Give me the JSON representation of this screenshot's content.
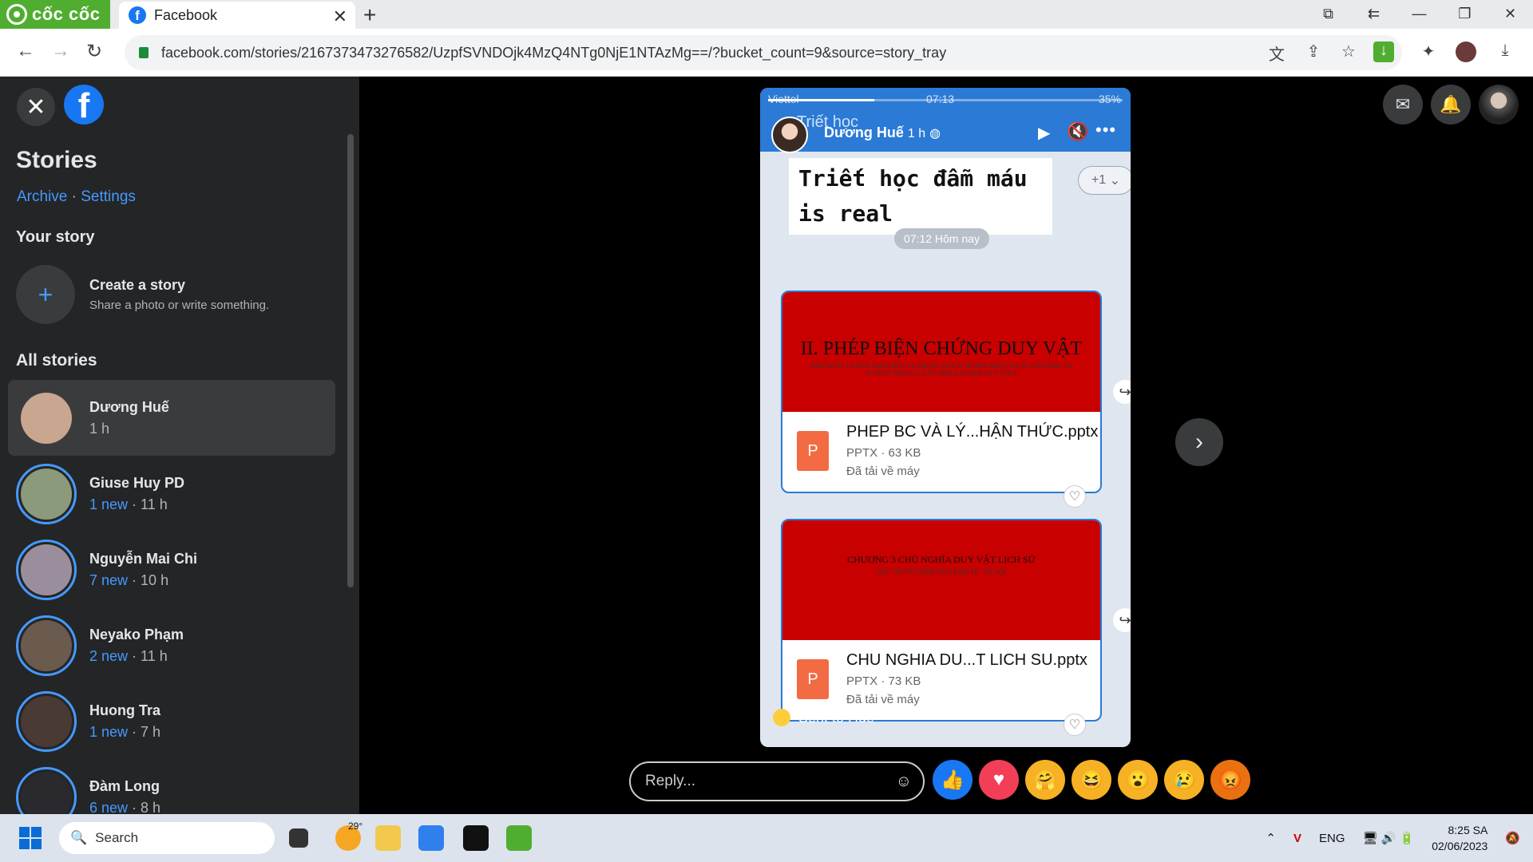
{
  "browser": {
    "brand": "cốc cốc",
    "tab_title": "Facebook",
    "url": "facebook.com/stories/2167373473276582/UzpfSVNDOjk4MzQ4NTg0NjE1NTAzMg==/?bucket_count=9&source=story_tray"
  },
  "sidebar": {
    "title": "Stories",
    "archive": "Archive",
    "settings": "Settings",
    "separator": "·",
    "your_story": "Your story",
    "create_title": "Create a story",
    "create_sub": "Share a photo or write something.",
    "all_stories": "All stories",
    "stories": [
      {
        "name": "Dương Huế",
        "new": "",
        "time": "1 h",
        "color": "#c9a68f"
      },
      {
        "name": "Giuse Huy PD",
        "new": "1 new",
        "time": "11 h",
        "color": "#8a9a7a"
      },
      {
        "name": "Nguyễn Mai Chi",
        "new": "7 new",
        "time": "10 h",
        "color": "#9a8e9c"
      },
      {
        "name": "Neyako Phạm",
        "new": "2 new",
        "time": "11 h",
        "color": "#6b5a4e"
      },
      {
        "name": "Huong Tra",
        "new": "1 new",
        "time": "7 h",
        "color": "#4a3a34"
      },
      {
        "name": "Đàm Long",
        "new": "6 new",
        "time": "8 h",
        "color": "#2a2a2e"
      }
    ],
    "meta_sep": " · "
  },
  "story": {
    "progress": 0.3,
    "status_left": "Viettel",
    "status_time": "07:13",
    "status_right": "35%",
    "ghost_title": "Triết học",
    "author": "Dương Huế",
    "author_time": "1 h",
    "caption": "Triết học đẫm máu is real",
    "plus_one": "+1",
    "day_chip": "07:12 Hôm nay",
    "files": [
      {
        "thumb_title": "II. PHÉP BIỆN CHỨNG DUY VẬT",
        "thumb_sub": "PHEP BCDV LA MON KHOA HOC VE NHUNG QUY LUAT PHO BIEN CUA SU VAN DONG VA SU PHAT TRIEN CUA TU NHIEN, XA HOI VA TU DUY",
        "name": "PHEP BC VÀ LÝ...HẬN THỨC.pptx",
        "meta": "PPTX · 63 KB",
        "status": "Đã tải về máy"
      },
      {
        "thumb_title": "CHƯƠNG 3 CHỦ NGHĨA DUY VẬT LỊCH SỬ",
        "thumb_sub": "HỌC THUYẾT HÌNH THÁI KINH TẾ - XÃ HỘI",
        "name": "CHU NGHIA DU...T LICH SU.pptx",
        "meta": "PPTX · 73 KB",
        "status": "Đã tải về máy"
      }
    ],
    "sent": "Sent to Huế"
  },
  "reply": {
    "placeholder": "Reply..."
  },
  "reactions": [
    "like",
    "love",
    "care",
    "haha",
    "wow",
    "sad",
    "angry"
  ],
  "taskbar": {
    "search": "Search",
    "temp": "29°",
    "lang": "ENG",
    "time": "8:25 SA",
    "date": "02/06/2023"
  }
}
